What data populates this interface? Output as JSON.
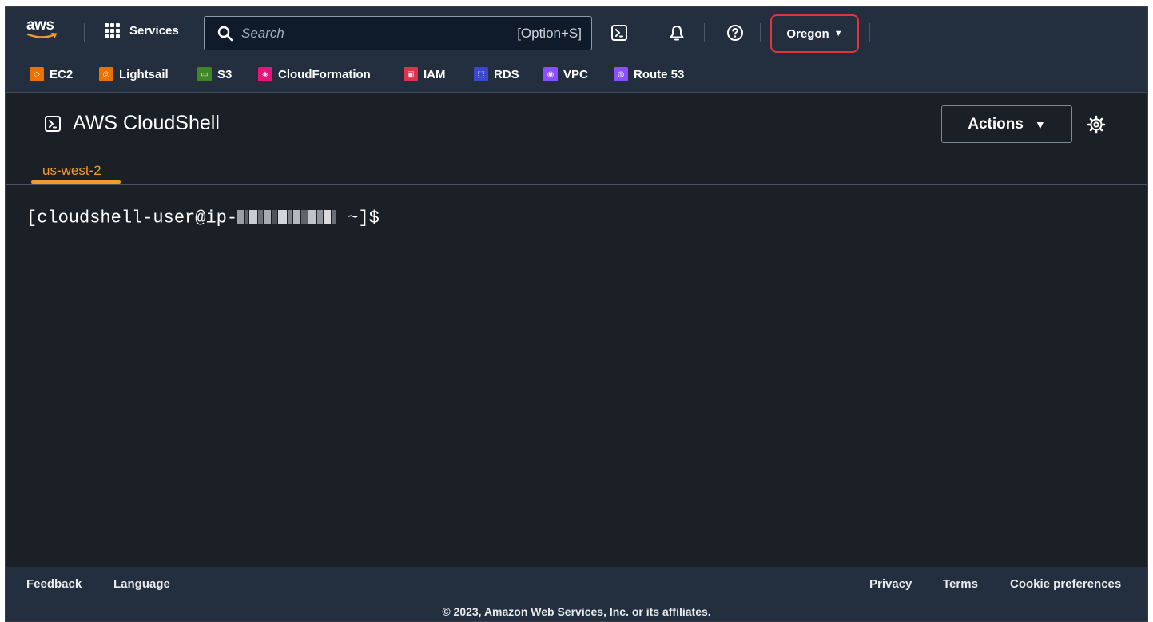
{
  "nav": {
    "logo_text": "aws",
    "services_label": "Services",
    "search_placeholder": "Search",
    "search_shortcut": "[Option+S]",
    "region_label": "Oregon",
    "region_caret": "▼"
  },
  "favorites": [
    {
      "label": "EC2",
      "color": "#ed7100"
    },
    {
      "label": "Lightsail",
      "color": "#ed7100"
    },
    {
      "label": "S3",
      "color": "#3f8624"
    },
    {
      "label": "CloudFormation",
      "color": "#e7157b"
    },
    {
      "label": "IAM",
      "color": "#dd344c"
    },
    {
      "label": "RDS",
      "color": "#3b48cc"
    },
    {
      "label": "VPC",
      "color": "#8c4fff"
    },
    {
      "label": "Route 53",
      "color": "#8c4fff"
    }
  ],
  "cloudshell": {
    "title": "AWS CloudShell",
    "actions_label": "Actions",
    "actions_caret": "▼",
    "tab_label": "us-west-2"
  },
  "terminal": {
    "prompt_prefix": "[cloudshell-user@ip-",
    "prompt_suffix": " ~]$"
  },
  "footer": {
    "feedback": "Feedback",
    "language": "Language",
    "privacy": "Privacy",
    "terms": "Terms",
    "cookie": "Cookie preferences",
    "copyright": "© 2023, Amazon Web Services, Inc. or its affiliates."
  },
  "colors": {
    "nav_bg": "#232f3e",
    "page_bg": "#1b1f26",
    "accent_orange": "#f29a2e",
    "region_highlight": "#e0353a"
  }
}
